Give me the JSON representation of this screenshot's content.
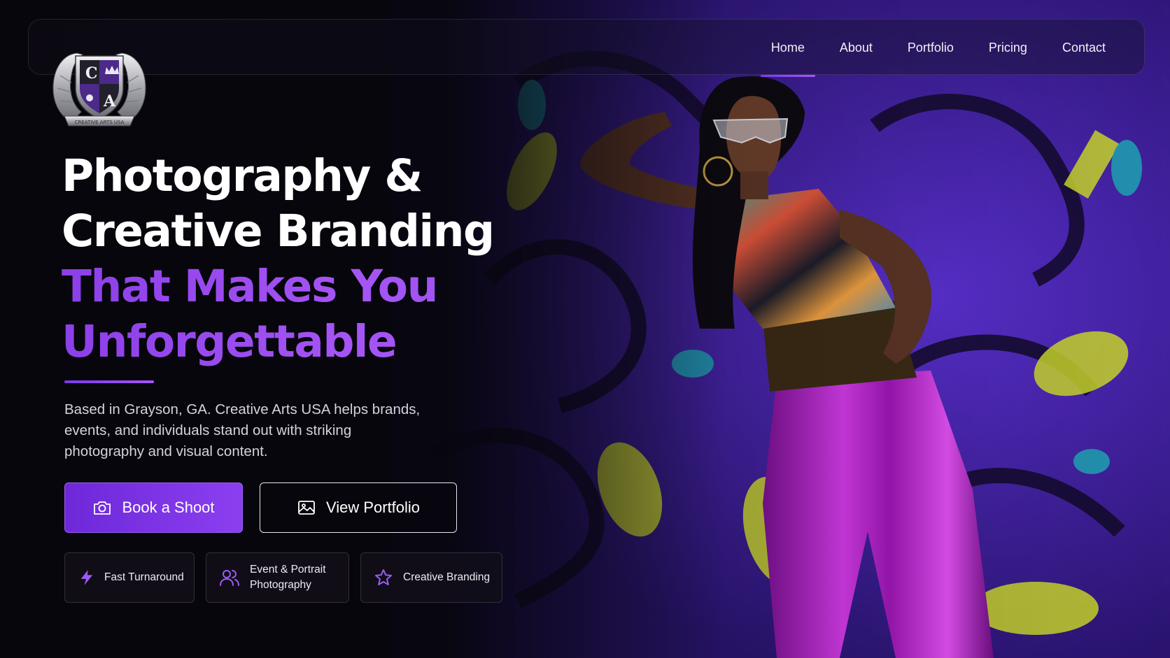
{
  "brand": {
    "logo_icon": "creative-arts-crest-icon",
    "logo_letters": [
      "C",
      "A"
    ],
    "logo_banner": "CREATIVE ARTS USA"
  },
  "nav": {
    "items": [
      {
        "label": "Home",
        "active": true
      },
      {
        "label": "About",
        "active": false
      },
      {
        "label": "Portfolio",
        "active": false
      },
      {
        "label": "Pricing",
        "active": false
      },
      {
        "label": "Contact",
        "active": false
      }
    ]
  },
  "hero": {
    "headline_line1": "Photography &",
    "headline_line2": "Creative Branding",
    "headline_accent1": "That Makes You",
    "headline_accent2": "Unforgettable",
    "intro": "Based in Grayson, GA. Creative Arts USA helps brands, events, and individuals stand out with striking photography and visual content."
  },
  "actions": {
    "primary_label": "Book a Shoot",
    "primary_icon": "camera-icon",
    "secondary_label": "View Portfolio",
    "secondary_icon": "image-icon"
  },
  "features": [
    {
      "label": "Fast Turnaround",
      "icon": "lightning-icon"
    },
    {
      "label": "Event & Portrait Photography",
      "icon": "users-icon"
    },
    {
      "label": "Creative Branding",
      "icon": "star-icon"
    }
  ],
  "colors": {
    "accent": "#8b3fe8",
    "accent_light": "#a855f7",
    "background": "#07060c",
    "graffiti_purple": "#4b25b8",
    "graffiti_yellow": "#c9d62a",
    "graffiti_teal": "#1f9bb0",
    "pants_magenta": "#b21ec8"
  }
}
